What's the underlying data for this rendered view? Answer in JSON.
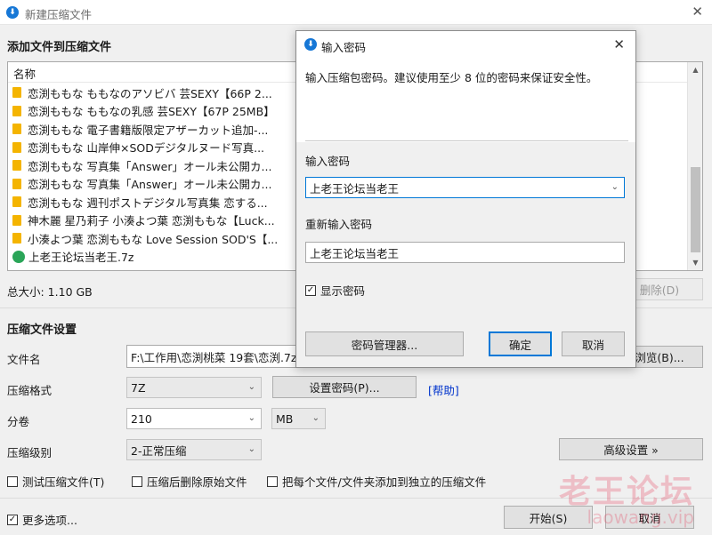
{
  "window": {
    "title": "新建压缩文件"
  },
  "add_section": {
    "title": "添加文件到压缩文件",
    "column_name": "名称",
    "files": [
      {
        "name": "恋渕ももな ももなのアソビバ 芸SEXY【66P 2...",
        "type": "folder"
      },
      {
        "name": "恋渕ももな ももなの乳感 芸SEXY【67P 25MB】",
        "type": "folder"
      },
      {
        "name": "恋渕ももな 電子書籍版限定アザーカット追加-...",
        "type": "folder"
      },
      {
        "name": "恋渕ももな 山岸伸×SODデジタルヌード写真...",
        "type": "folder"
      },
      {
        "name": "恋渕ももな 写真集「Answer」オール未公開カ...",
        "type": "folder"
      },
      {
        "name": "恋渕ももな 写真集「Answer」オール未公開カ...",
        "type": "folder"
      },
      {
        "name": "恋渕ももな 週刊ポストデジタル写真集 恋する...",
        "type": "folder"
      },
      {
        "name": "神木麗 星乃莉子 小湊よつ葉 恋渕ももな【Luck...",
        "type": "folder"
      },
      {
        "name": "小湊よつ葉 恋渕ももな Love Session SOD'S【...",
        "type": "folder"
      },
      {
        "name": "上老王论坛当老王.7z",
        "type": "archive"
      }
    ],
    "total_size": "总大小: 1.10 GB",
    "delete_button": "删除(D)"
  },
  "settings": {
    "title": "压缩文件设置",
    "filename_label": "文件名",
    "filename_value": "F:\\工作用\\恋渕桃菜 19套\\恋渕.7z",
    "browse_button": "浏览(B)...",
    "format_label": "压缩格式",
    "format_value": "7Z",
    "set_password_button": "设置密码(P)...",
    "help_link": "[帮助]",
    "split_label": "分卷",
    "split_value": "210",
    "split_unit": "MB",
    "level_label": "压缩级别",
    "level_value": "2-正常压缩",
    "advanced_button": "高级设置 »",
    "test_archive": "测试压缩文件(T)",
    "delete_after": "压缩后删除原始文件",
    "separate_archives": "把每个文件/文件夹添加到独立的压缩文件",
    "more_options": "更多选项...",
    "more_options_checked": "✓",
    "start_button": "开始(S)",
    "cancel_button": "取消"
  },
  "dialog": {
    "title": "输入密码",
    "description": "输入压缩包密码。建议使用至少 8 位的密码来保证安全性。",
    "password_label": "输入密码",
    "password_value": "上老王论坛当老王",
    "reenter_label": "重新输入密码",
    "reenter_value": "上老王论坛当老王",
    "show_password": "显示密码",
    "show_password_checked": "✓",
    "manager_button": "密码管理器...",
    "ok_button": "确定",
    "cancel_button": "取消"
  },
  "watermark": {
    "cn": "老王论坛",
    "en": "laowang.vip"
  },
  "colors": {
    "accent": "#0078d7",
    "app_icon": "#1677d6",
    "folder": "#f4b400",
    "link": "#0033cc"
  }
}
